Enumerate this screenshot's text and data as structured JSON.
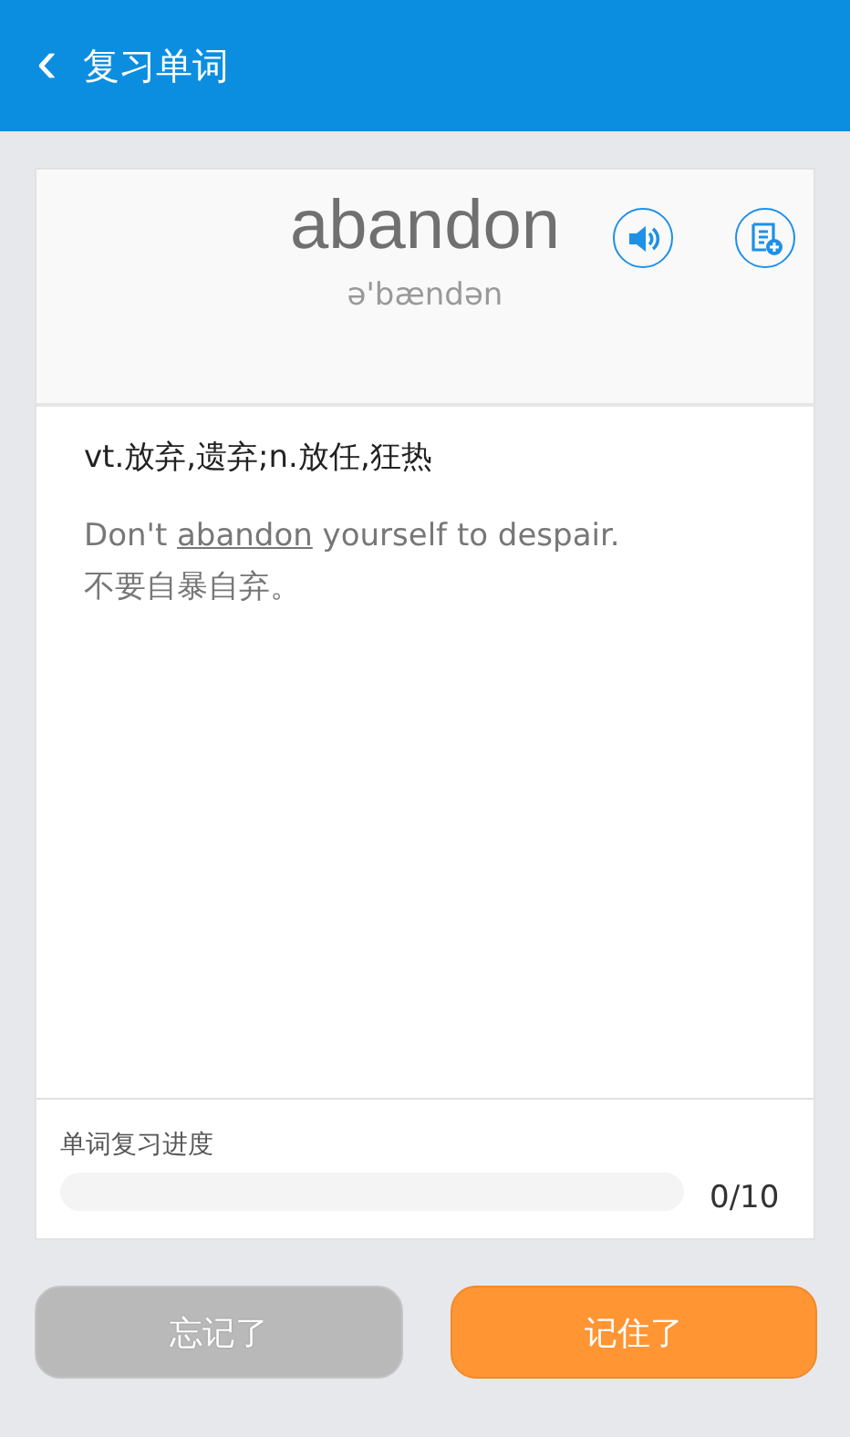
{
  "header": {
    "back_icon": "‹",
    "title": "复习单词"
  },
  "word": {
    "text": "abandon",
    "phonetic": "ə'bændən"
  },
  "definition": "vt.放弃,遗弃;n.放任,狂热",
  "example": {
    "parts": [
      {
        "text": "Don't ",
        "highlighted": false
      },
      {
        "text": "abandon",
        "highlighted": true
      },
      {
        "text": " yourself to despair.",
        "highlighted": false
      }
    ],
    "translation": "不要自暴自弃。"
  },
  "progress": {
    "label": "单词复习进度",
    "level": 0,
    "reading": "0/10"
  },
  "buttons": [
    {
      "label": "忘记了",
      "kind": "secondary"
    },
    {
      "label": "记住了",
      "kind": "primary"
    }
  ]
}
